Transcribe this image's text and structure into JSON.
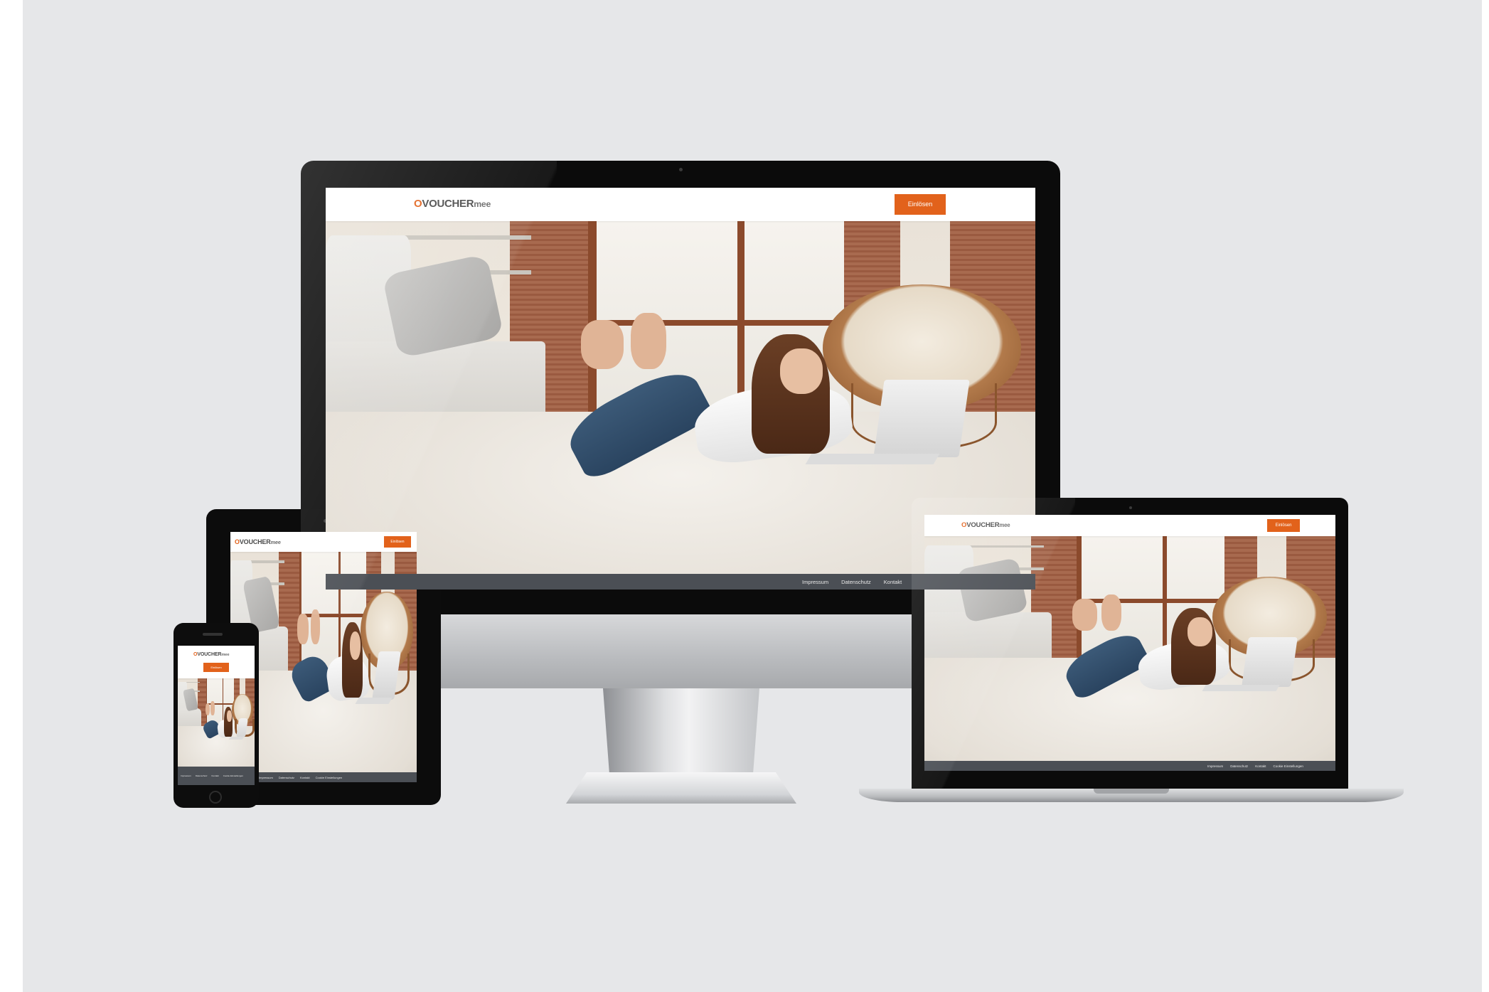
{
  "brand": {
    "logo_o": "O",
    "logo_main": "VOUCHER",
    "logo_suffix": "mee",
    "accent_color": "#e2621b"
  },
  "header": {
    "cta_label": "Einlösen"
  },
  "footer": {
    "links": [
      "Impressum",
      "Datenschutz",
      "Kontakt",
      "Cookie Einstellungen"
    ]
  },
  "devices": [
    "desktop",
    "tablet",
    "phone",
    "laptop"
  ]
}
